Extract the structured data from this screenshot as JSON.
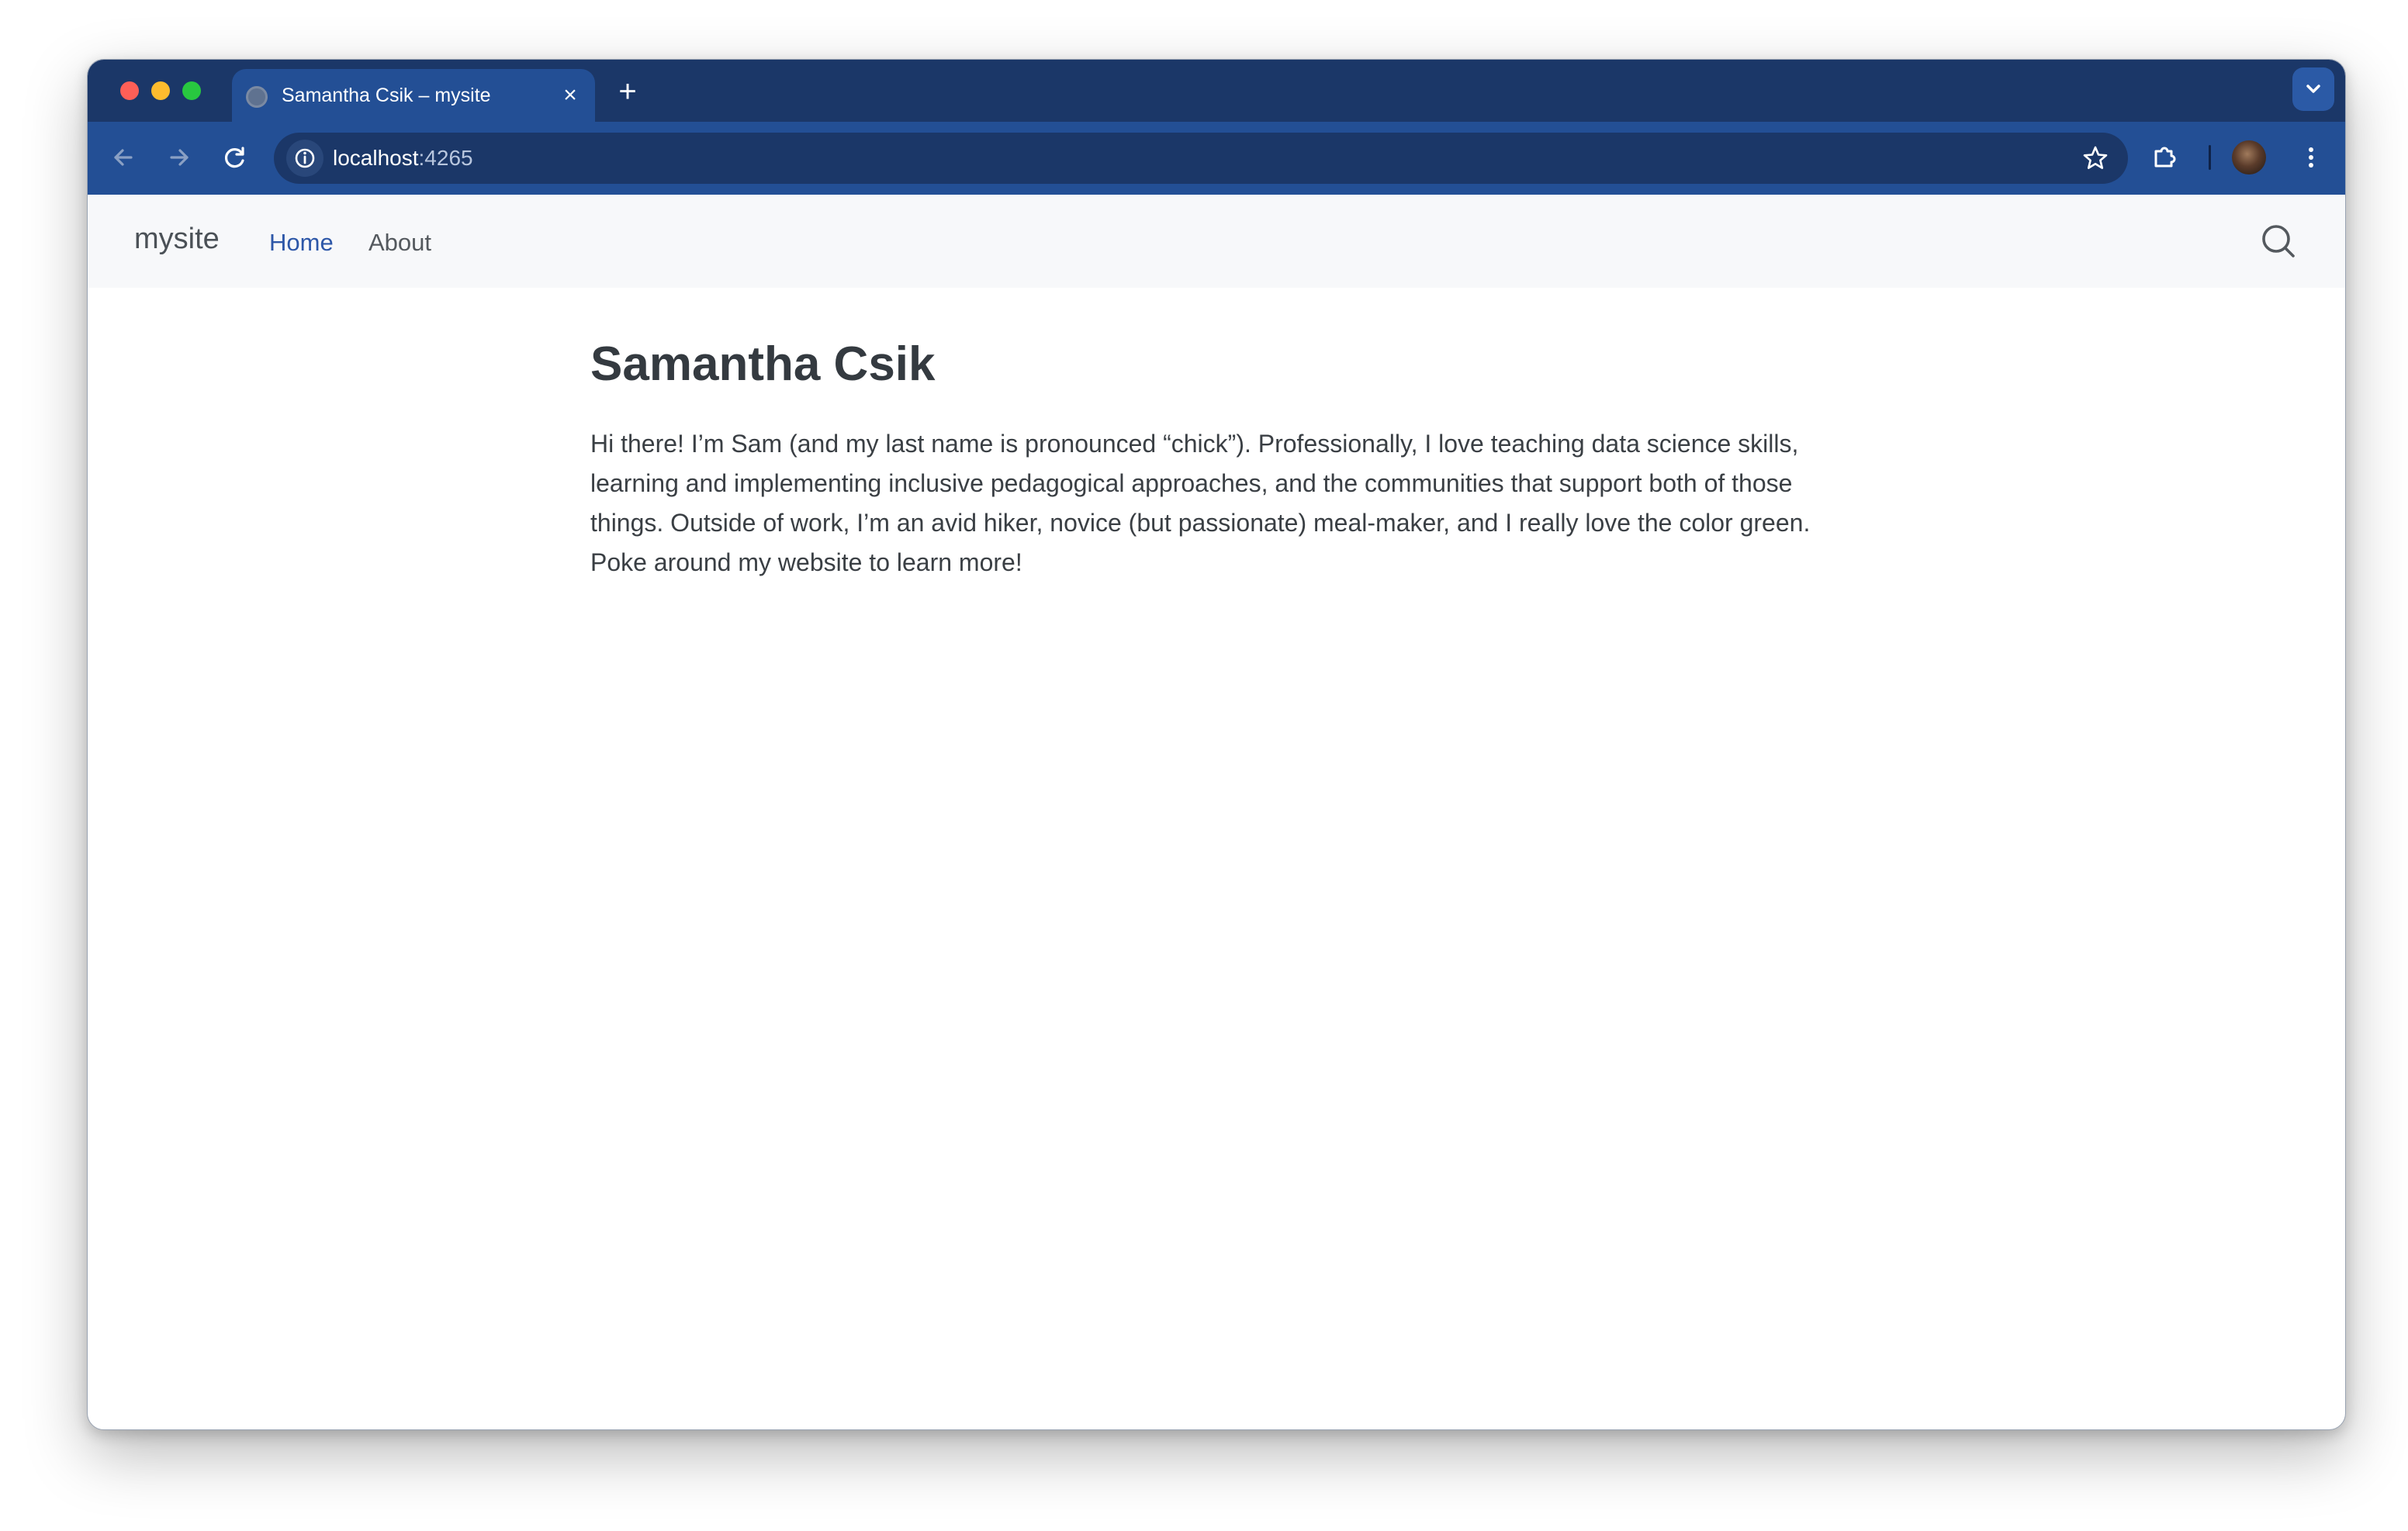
{
  "browser": {
    "tab": {
      "title": "Samantha Csik – mysite",
      "close_label": "×"
    },
    "new_tab_label": "+",
    "address": {
      "host": "localhost",
      "port": ":4265"
    }
  },
  "site": {
    "brand": "mysite",
    "nav": [
      {
        "label": "Home",
        "active": true
      },
      {
        "label": "About",
        "active": false
      }
    ]
  },
  "page": {
    "title": "Samantha Csik",
    "intro": "Hi there! I’m Sam (and my last name is pronounced “chick”). Professionally, I love teaching data science skills, learning and implementing inclusive pedagogical approaches, and the communities that support both of those things. Outside of work, I’m an avid hiker, novice (but passionate) meal-maker, and I really love the color green. Poke around my website to learn more!"
  },
  "colors": {
    "tabstrip": "#1b3768",
    "toolbar": "#234f95",
    "active_link": "#2d57a8",
    "heading": "#343a40"
  },
  "icons": [
    "globe-icon",
    "close-icon",
    "plus-icon",
    "chevron-down-icon",
    "back-arrow-icon",
    "forward-arrow-icon",
    "reload-icon",
    "info-icon",
    "star-icon",
    "puzzle-icon",
    "profile-avatar",
    "kebab-menu-icon",
    "search-icon"
  ]
}
